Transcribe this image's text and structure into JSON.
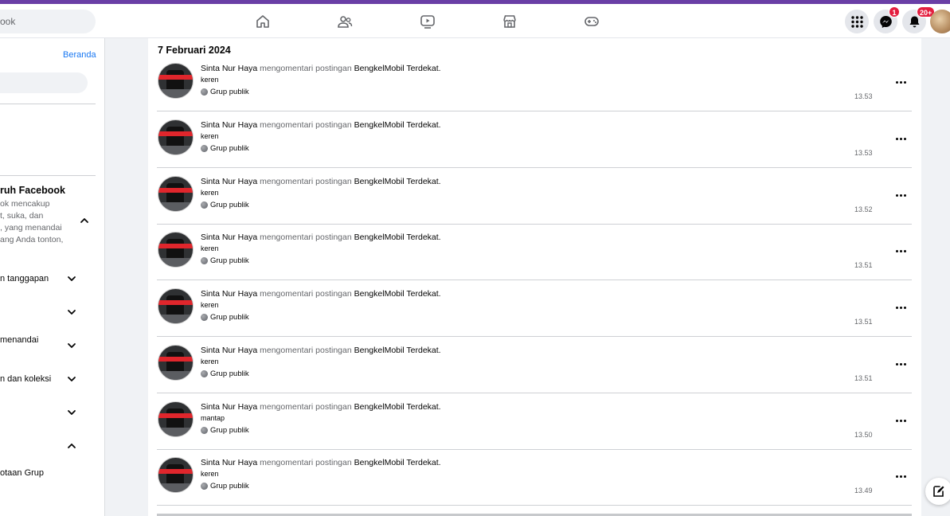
{
  "topbar": {
    "search_text": "ook",
    "messenger_badge": "1",
    "notifications_badge": "20+"
  },
  "sidebar": {
    "beranda_link": "Beranda",
    "section_title": "ruh Facebook",
    "section_desc": [
      "ok mencakup",
      "t, suka, dan",
      ", yang menandai",
      "ang Anda tonton,"
    ],
    "items": [
      {
        "label": "n tanggapan"
      },
      {
        "label": ""
      },
      {
        "label": " menandai"
      },
      {
        "label": "n dan koleksi"
      },
      {
        "label": ""
      },
      {
        "label": ""
      },
      {
        "label": "otaan Grup"
      }
    ]
  },
  "main": {
    "date_header": "7 Februari 2024",
    "activities": [
      {
        "actor": "Sinta Nur Haya",
        "verb": "mengomentari postingan",
        "target": "BengkelMobil Terdekat.",
        "comment": "keren",
        "audience": "Grup publik",
        "time": "13.53"
      },
      {
        "actor": "Sinta Nur Haya",
        "verb": "mengomentari postingan",
        "target": "BengkelMobil Terdekat.",
        "comment": "keren",
        "audience": "Grup publik",
        "time": "13.53"
      },
      {
        "actor": "Sinta Nur Haya",
        "verb": "mengomentari postingan",
        "target": "BengkelMobil Terdekat.",
        "comment": "keren",
        "audience": "Grup publik",
        "time": "13.52"
      },
      {
        "actor": "Sinta Nur Haya",
        "verb": "mengomentari postingan",
        "target": "BengkelMobil Terdekat.",
        "comment": "keren",
        "audience": "Grup publik",
        "time": "13.51"
      },
      {
        "actor": "Sinta Nur Haya",
        "verb": "mengomentari postingan",
        "target": "BengkelMobil Terdekat.",
        "comment": "keren",
        "audience": "Grup publik",
        "time": "13.51"
      },
      {
        "actor": "Sinta Nur Haya",
        "verb": "mengomentari postingan",
        "target": "BengkelMobil Terdekat.",
        "comment": "keren",
        "audience": "Grup publik",
        "time": "13.51"
      },
      {
        "actor": "Sinta Nur Haya",
        "verb": "mengomentari postingan",
        "target": "BengkelMobil Terdekat.",
        "comment": "mantap",
        "audience": "Grup publik",
        "time": "13.50"
      },
      {
        "actor": "Sinta Nur Haya",
        "verb": "mengomentari postingan",
        "target": "BengkelMobil Terdekat.",
        "comment": "keren",
        "audience": "Grup publik",
        "time": "13.49"
      }
    ]
  },
  "colors": {
    "top_stripe": "#6a3fa6",
    "link_blue": "#1877f2",
    "badge_red": "#e41e3f"
  },
  "icons": [
    "home-icon",
    "friends-icon",
    "watch-icon",
    "marketplace-icon",
    "gaming-icon",
    "menu-grid-icon",
    "messenger-icon",
    "bell-icon",
    "globe-icon",
    "more-icon",
    "chevron-up-icon",
    "chevron-down-icon",
    "edit-icon"
  ]
}
